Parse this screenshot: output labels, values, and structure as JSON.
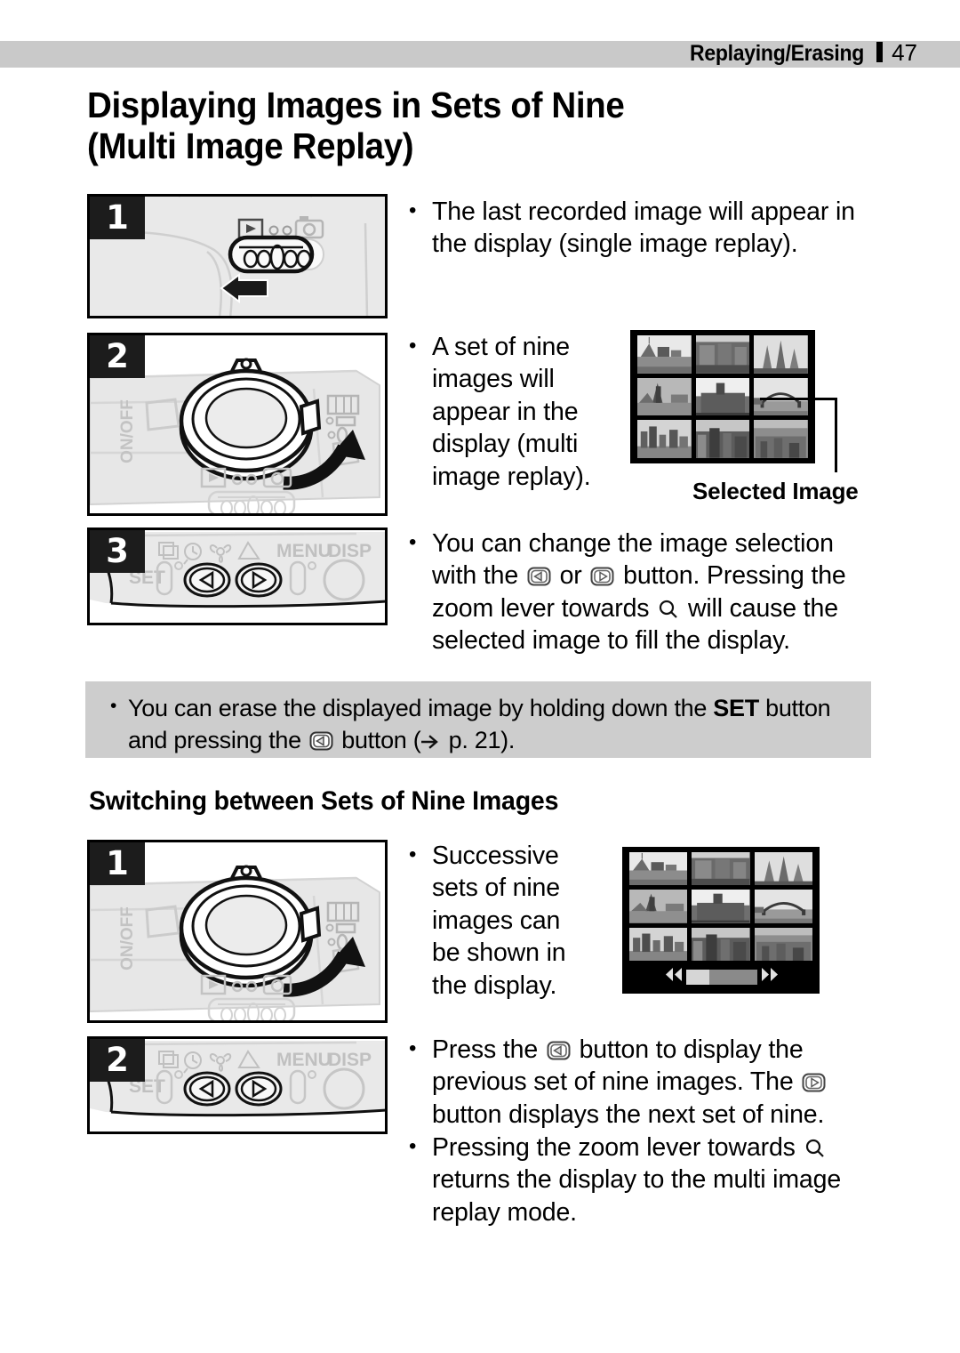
{
  "header": {
    "section_label": "Replaying/Erasing",
    "page_number": "47"
  },
  "page_title": {
    "line1": "Displaying Images in Sets of Nine",
    "line2": "(Multi Image Replay)"
  },
  "section_title": "Switching between Sets of Nine Images",
  "steps_section1": [
    {
      "number": "1",
      "illustration": "camera-mode-slider-playback"
    },
    {
      "number": "2",
      "illustration": "camera-top-zoom-lever"
    },
    {
      "number": "3",
      "illustration": "camera-rear-button-panel"
    }
  ],
  "steps_section2": [
    {
      "number": "1",
      "illustration": "camera-top-zoom-lever"
    },
    {
      "number": "2",
      "illustration": "camera-rear-button-panel"
    }
  ],
  "bullets_section1": [
    {
      "id": "last-recorded-image",
      "text": "The last recorded image will appear in the display (single image replay)."
    },
    {
      "id": "set-of-nine",
      "text": "A set of nine images will appear in the display (multi image replay)."
    }
  ],
  "bullet_change_selection": {
    "part1": "You can change the image selection with the ",
    "part2": " or ",
    "part3": " button. Pressing the zoom lever towards ",
    "part4": " will cause the selected image to fill the display."
  },
  "note": {
    "part1": "You can erase the displayed image by holding down the ",
    "set_label": "SET",
    "part2": " button and pressing the ",
    "part3": " button (",
    "page_ref": " p. 21)."
  },
  "bullets_section2": [
    {
      "id": "successive-sets",
      "text": "Successive sets of nine images can be shown in the display."
    }
  ],
  "bullet_prev_next": {
    "part1": "Press the ",
    "part2": " button to display the previous set of nine images. The ",
    "part3": " button displays the next set of nine."
  },
  "bullet_zoom_return": {
    "part1": "Pressing the zoom lever towards ",
    "part2": " returns the display to the multi image replay mode."
  },
  "callout": {
    "label": "Selected Image"
  },
  "camera_labels": {
    "on_off": "ON/OFF",
    "set": "SET",
    "menu": "MENU",
    "disp": "DISP"
  },
  "colors": {
    "header_band": "#c9c9c9",
    "note_bg": "#cdcdcd",
    "badge_bg": "#1c1c1c",
    "body_bg": "#e8e8e8",
    "lcd_bg": "#000000"
  },
  "icons": {
    "left_button": "left-arrow-button-icon",
    "right_button": "right-arrow-button-icon",
    "magnifier": "magnifier-icon",
    "page_arrow": "page-reference-arrow-icon",
    "playback": "playback-icon",
    "camera": "camera-icon",
    "flash": "flash-icon",
    "continuous": "continuous-shooting-icon",
    "self_timer": "self-timer-icon",
    "macro": "macro-flower-icon",
    "landscape": "landscape-mountain-icon"
  }
}
